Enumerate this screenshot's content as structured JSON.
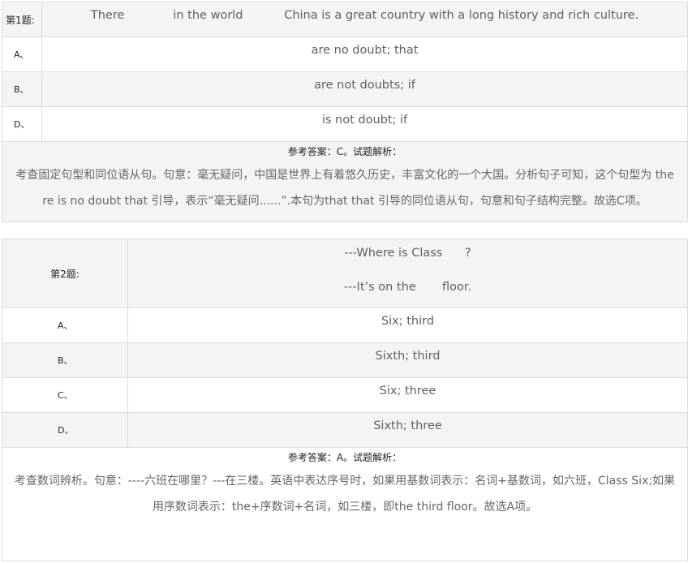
{
  "questions": [
    {
      "label": "第1题:",
      "stem": "There             in the world           China is a great country with a long history and rich culture.",
      "options": [
        {
          "letter": "A、",
          "text": "are no doubt; that"
        },
        {
          "letter": "B、",
          "text": "are not doubts; if"
        },
        {
          "letter": "D、",
          "text": "is not doubt; if"
        }
      ],
      "answer_title": "参考答案：C。试题解析：",
      "explanation_line1": "考查固定句型和同位语从句。句意：毫无疑问，中国是世界上有着悠久历史，丰富文化的一个大国。分析句子可知，这个句型为 the",
      "explanation_line2": "re is no doubt that 引导，表示“毫无疑问......”.本句为that that 引导的同位语从句，句意和句子结构完整。故选C项。"
    },
    {
      "label": "第2题:",
      "stem_line1": "---Where is Class      ?",
      "stem_line2": "---It’s on the       floor.",
      "options": [
        {
          "letter": "A、",
          "text": "Six; third"
        },
        {
          "letter": "B、",
          "text": "Sixth; third"
        },
        {
          "letter": "C、",
          "text": "Six; three"
        },
        {
          "letter": "D、",
          "text": "Sixth; three"
        }
      ],
      "answer_title": "参考答案：A。试题解析：",
      "explanation_line1": "考查数词辨析。句意：----六班在哪里？---在三楼。英语中表达序号时，如果用基数词表示：名词+基数词，如六班，Class Six;如果",
      "explanation_line2": "用序数词表示：the+序数词+名词，如三楼，即the third floor。故选A项。"
    }
  ]
}
